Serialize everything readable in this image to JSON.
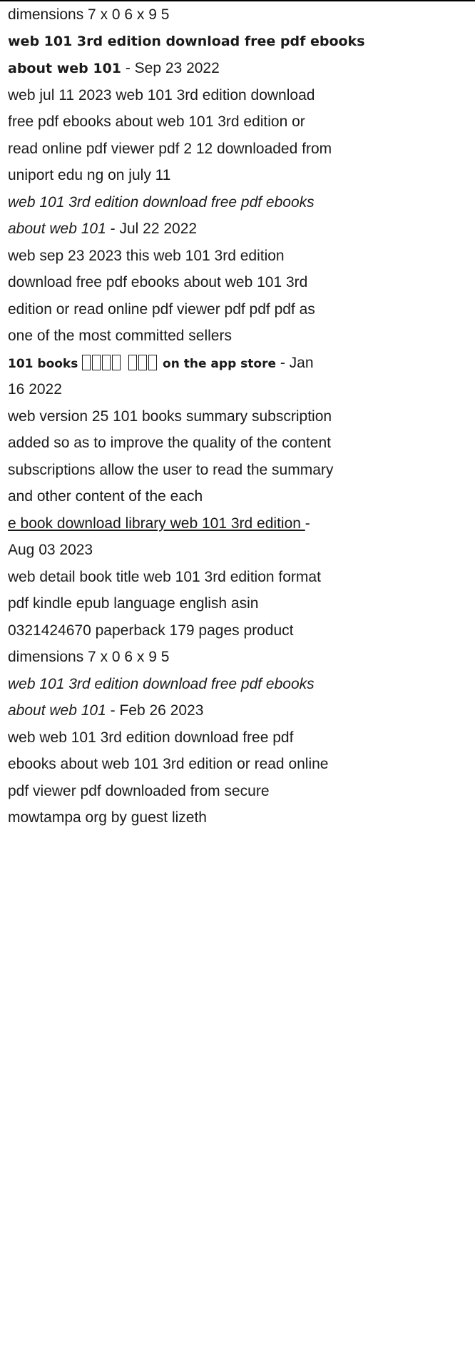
{
  "entries": [
    {
      "body_lines": [
        "dimensions 7 x 0 6 x 9 5"
      ]
    },
    {
      "title_lines": [
        "web 101 3rd edition download free pdf ebooks",
        "about web 101"
      ],
      "date": " - Sep 23 2022",
      "body_lines": [
        "web jul 11 2023   web 101 3rd edition download",
        "free pdf ebooks about web 101 3rd edition or",
        "read online pdf viewer pdf 2 12 downloaded from",
        "uniport edu ng on july 11"
      ]
    },
    {
      "title_lines": [
        "web 101 3rd edition download free pdf ebooks",
        "about web 101"
      ],
      "date": " - Jul 22 2022",
      "body_lines": [
        "web sep 23 2023   this web 101 3rd edition",
        "download free pdf ebooks about web 101 3rd",
        "edition or read online pdf viewer pdf pdf pdf as",
        "one of the most committed sellers"
      ]
    },
    {
      "title_prefix": "101 books",
      "title_suffix": "on the app store",
      "date": " - Jan",
      "date_cont": "16 2022",
      "body_lines": [
        "web version 25 101 books summary subscription",
        "added so as to improve the quality of the content",
        "subscriptions allow the user to read the summary",
        "and other content of the each"
      ]
    },
    {
      "title_lines": [
        "e book download library web 101 3rd edition "
      ],
      "date": "-",
      "date_cont": "Aug 03 2023",
      "body_lines": [
        "web detail book title web 101 3rd edition format",
        "pdf kindle epub language english asin",
        "0321424670 paperback 179 pages product",
        "dimensions 7 x 0 6 x 9 5"
      ]
    },
    {
      "title_lines": [
        "web 101 3rd edition download free pdf ebooks",
        "about web 101"
      ],
      "date": " - Feb 26 2023",
      "body_lines": [
        "web web 101 3rd edition download free pdf",
        "ebooks about web 101 3rd edition or read online",
        "pdf viewer pdf downloaded from secure",
        "mowtampa org by guest lizeth"
      ]
    }
  ]
}
